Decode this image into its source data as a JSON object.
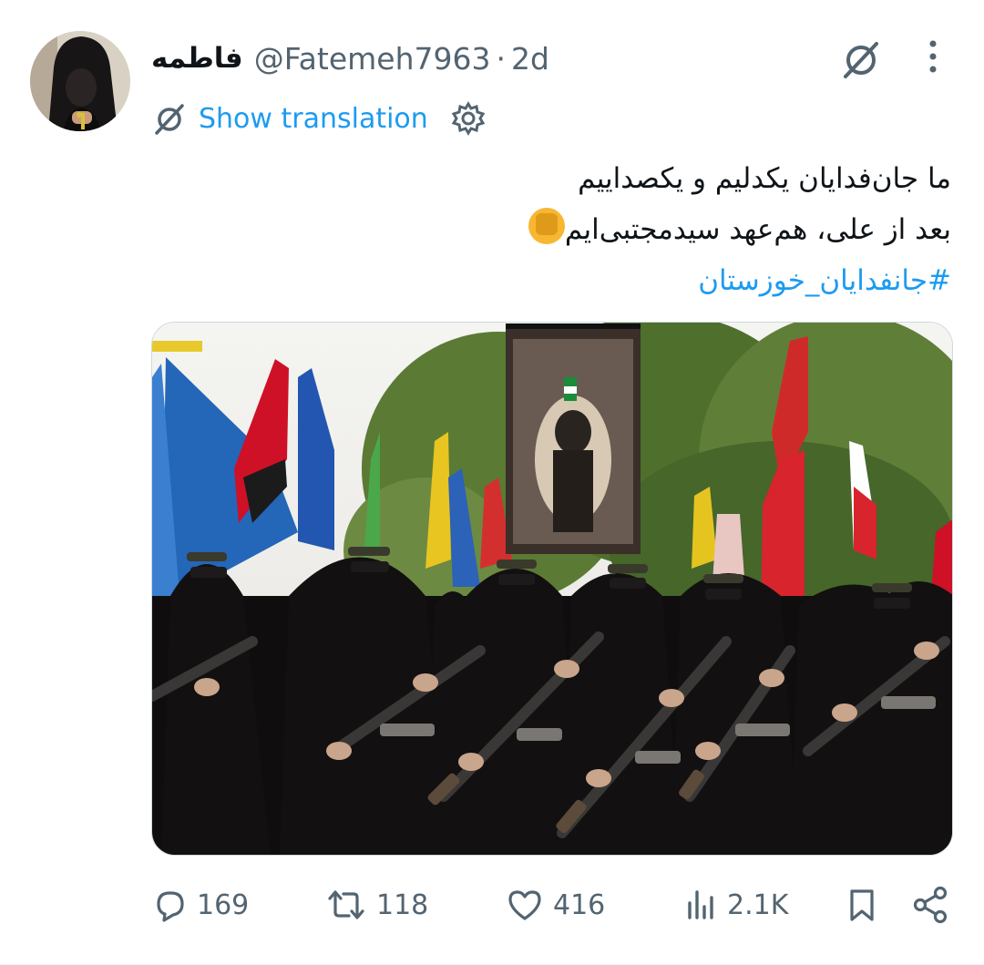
{
  "author": {
    "display_name": "فاطمه",
    "handle": "@Fatemeh7963",
    "separator": "·",
    "time": "2d"
  },
  "translation": {
    "label": "Show translation"
  },
  "tweet": {
    "line1": "ما جان‌فدایان یکدلیم و یکصداییم",
    "line2": "بعد از علی، هم‌عهد سیدمجتبی‌ایم",
    "hashtag": "#جانفدایان_خوزستان"
  },
  "metrics": {
    "replies": "169",
    "retweets": "118",
    "likes": "416",
    "views": "2.1K"
  },
  "icons": {
    "grok": "no-translate-icon",
    "more": "more-icon",
    "settings": "gear-icon",
    "reply": "reply-icon",
    "retweet": "retweet-icon",
    "like": "heart-icon",
    "views": "views-icon",
    "bookmark": "bookmark-icon",
    "share": "share-icon"
  },
  "colors": {
    "accent": "#1d9bf0",
    "muted": "#536471",
    "text": "#0f1419"
  }
}
